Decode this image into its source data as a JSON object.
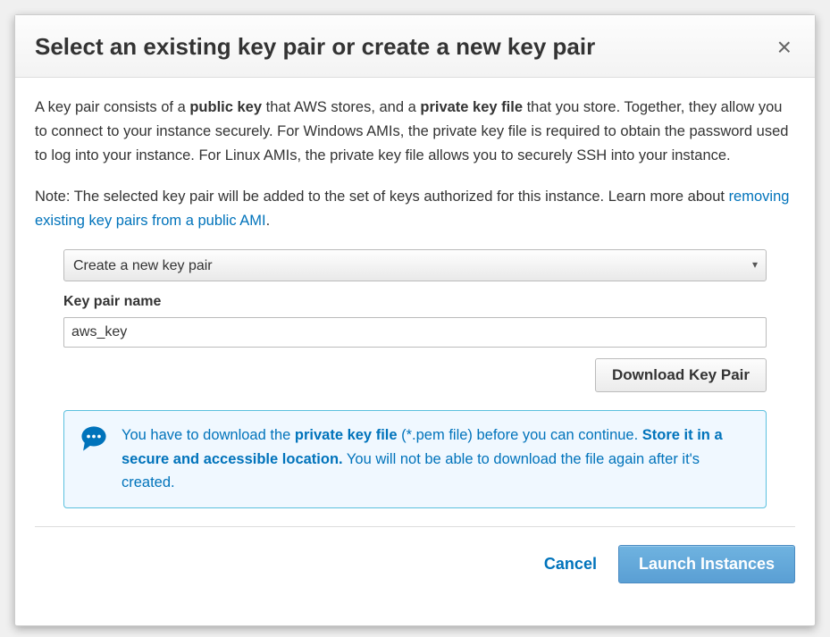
{
  "modal": {
    "title": "Select an existing key pair or create a new key pair",
    "close_label": "×"
  },
  "description": {
    "p1_a": "A key pair consists of a ",
    "p1_b": "public key",
    "p1_c": " that AWS stores, and a ",
    "p1_d": "private key file",
    "p1_e": " that you store. Together, they allow you to connect to your instance securely. For Windows AMIs, the private key file is required to obtain the password used to log into your instance. For Linux AMIs, the private key file allows you to securely SSH into your instance."
  },
  "note": {
    "text_a": "Note: The selected key pair will be added to the set of keys authorized for this instance. Learn more about ",
    "link_text": "removing existing key pairs from a public AMI",
    "text_b": "."
  },
  "form": {
    "select_value": "Create a new key pair",
    "label": "Key pair name",
    "input_value": "aws_key",
    "download_button": "Download Key Pair"
  },
  "info": {
    "t1": "You have to download the ",
    "t2": "private key file",
    "t3": " (*.pem file) before you can continue. ",
    "t4": "Store it in a secure and accessible location.",
    "t5": " You will not be able to download the file again after it's created."
  },
  "footer": {
    "cancel": "Cancel",
    "launch": "Launch Instances"
  }
}
